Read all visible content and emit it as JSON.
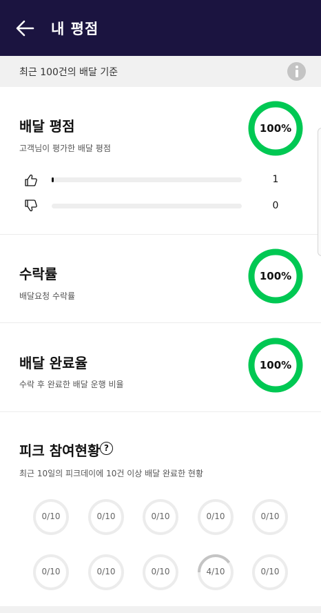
{
  "header": {
    "title": "내 평점",
    "back_icon": "arrow-left-icon"
  },
  "subheader": {
    "text": "최근 100건의 배달 기준",
    "info_icon": "info-icon"
  },
  "rating": {
    "title": "배달 평점",
    "description": "고객님이 평가한 배달 평점",
    "percent_label": "100%",
    "percent_value": 100,
    "like": {
      "icon": "thumbs-up-icon",
      "count": "1",
      "fill_fraction": 0.01
    },
    "dislike": {
      "icon": "thumbs-down-icon",
      "count": "0",
      "fill_fraction": 0
    }
  },
  "acceptance": {
    "title": "수락률",
    "description": "배달요청 수락률",
    "percent_label": "100%",
    "percent_value": 100
  },
  "completion": {
    "title": "배달 완료율",
    "description": "수락 후 완료한 배달 운행 비율",
    "percent_label": "100%",
    "percent_value": 100
  },
  "pick": {
    "title": "피크 참여현황",
    "help_icon": "question-circle-icon",
    "help_glyph": "?",
    "description": "최근 10일의 피크데이에 10건 이상 배달 완료한 현황",
    "days": [
      {
        "label": "0/10",
        "done": 0
      },
      {
        "label": "0/10",
        "done": 0
      },
      {
        "label": "0/10",
        "done": 0
      },
      {
        "label": "0/10",
        "done": 0
      },
      {
        "label": "0/10",
        "done": 0
      },
      {
        "label": "0/10",
        "done": 0
      },
      {
        "label": "0/10",
        "done": 0
      },
      {
        "label": "0/10",
        "done": 0
      },
      {
        "label": "4/10",
        "done": 4
      },
      {
        "label": "0/10",
        "done": 0
      }
    ]
  },
  "colors": {
    "header_bg": "#1b1440",
    "ring_green": "#00c853",
    "pick_ring": "#ececec",
    "pick_progress": "#c4c4c4"
  }
}
